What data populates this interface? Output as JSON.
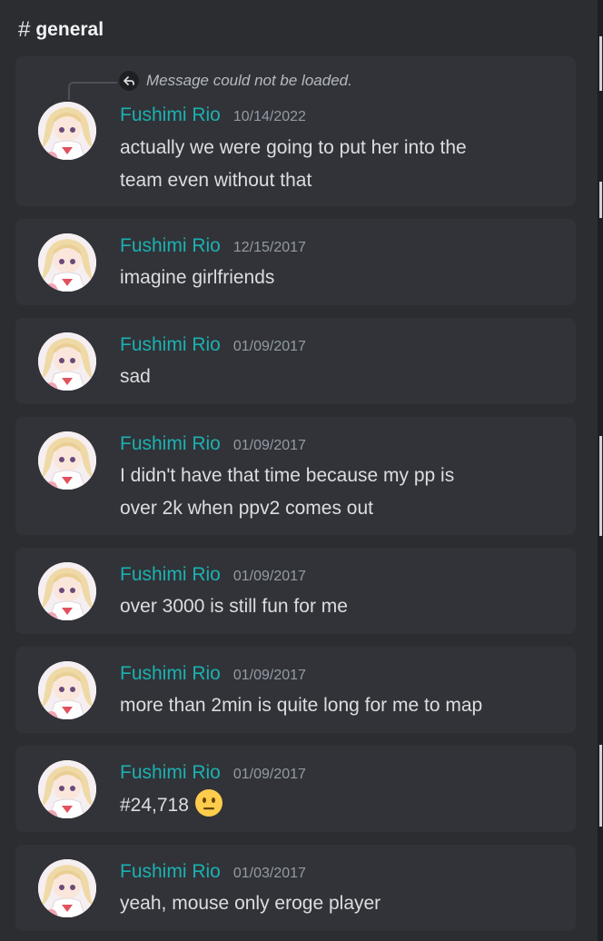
{
  "channel": {
    "icon": "hash-icon",
    "hash": "#",
    "name": "general"
  },
  "reply": {
    "icon": "reply-arrow-icon",
    "text": "Message could not be loaded."
  },
  "messages": [
    {
      "author": "Fushimi Rio",
      "timestamp": "10/14/2022",
      "lines": [
        "actually we were going to put her into the",
        "team even without that"
      ],
      "has_reply": true
    },
    {
      "author": "Fushimi Rio",
      "timestamp": "12/15/2017",
      "lines": [
        "imagine girlfriends"
      ]
    },
    {
      "author": "Fushimi Rio",
      "timestamp": "01/09/2017",
      "lines": [
        "sad"
      ]
    },
    {
      "author": "Fushimi Rio",
      "timestamp": "01/09/2017",
      "lines": [
        "I didn't have that time because my pp is",
        "over 2k when ppv2 comes out"
      ]
    },
    {
      "author": "Fushimi Rio",
      "timestamp": "01/09/2017",
      "lines": [
        "over 3000 is still fun for me"
      ]
    },
    {
      "author": "Fushimi Rio",
      "timestamp": "01/09/2017",
      "lines": [
        "more than 2min is quite long for me to map"
      ]
    },
    {
      "author": "Fushimi Rio",
      "timestamp": "01/09/2017",
      "lines": [
        "#24,718"
      ],
      "emoji": "neutral-face-emoji"
    },
    {
      "author": "Fushimi Rio",
      "timestamp": "01/03/2017",
      "lines": [
        "yeah, mouse only eroge player"
      ]
    }
  ],
  "colors": {
    "background": "#2b2d31",
    "message_card": "#313338",
    "author": "#1bb1b1",
    "timestamp": "#949ba4",
    "text": "#dbdee1"
  }
}
